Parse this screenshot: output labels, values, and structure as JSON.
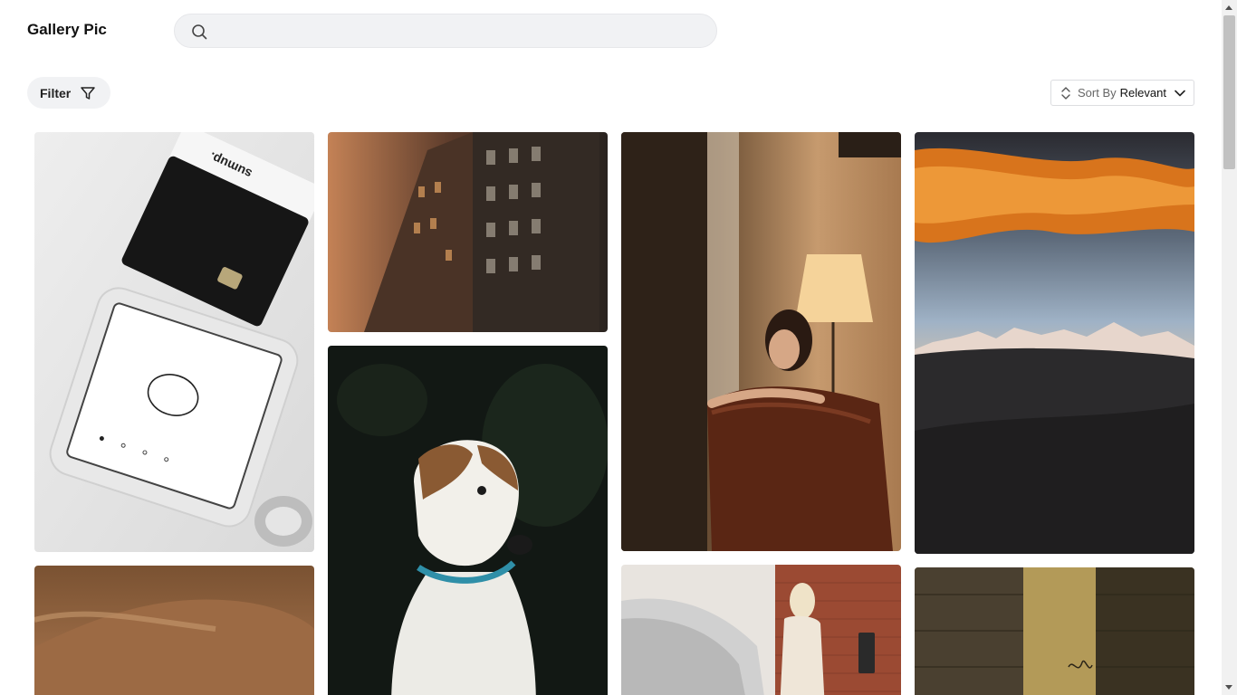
{
  "app": {
    "title": "Gallery Pic"
  },
  "search": {
    "placeholder": "",
    "value": ""
  },
  "toolbar": {
    "filter_label": "Filter",
    "sort_label": "Sort By",
    "sort_value": "Relevant"
  },
  "gallery": {
    "photos": [
      {
        "subject": "card payment terminal and card",
        "brand_text": "sumup."
      },
      {
        "subject": "brick building facade"
      },
      {
        "subject": "woman on leather sofa by lamp"
      },
      {
        "subject": "mountain range at sunset"
      },
      {
        "subject": "sand dune"
      },
      {
        "subject": "dog portrait"
      },
      {
        "subject": "woman charging electric car"
      },
      {
        "subject": "alley wall with graffiti"
      }
    ]
  },
  "colors": {
    "search_bg": "#f1f2f4",
    "filter_bg": "#f1f2f4",
    "border": "#dcdde0"
  }
}
